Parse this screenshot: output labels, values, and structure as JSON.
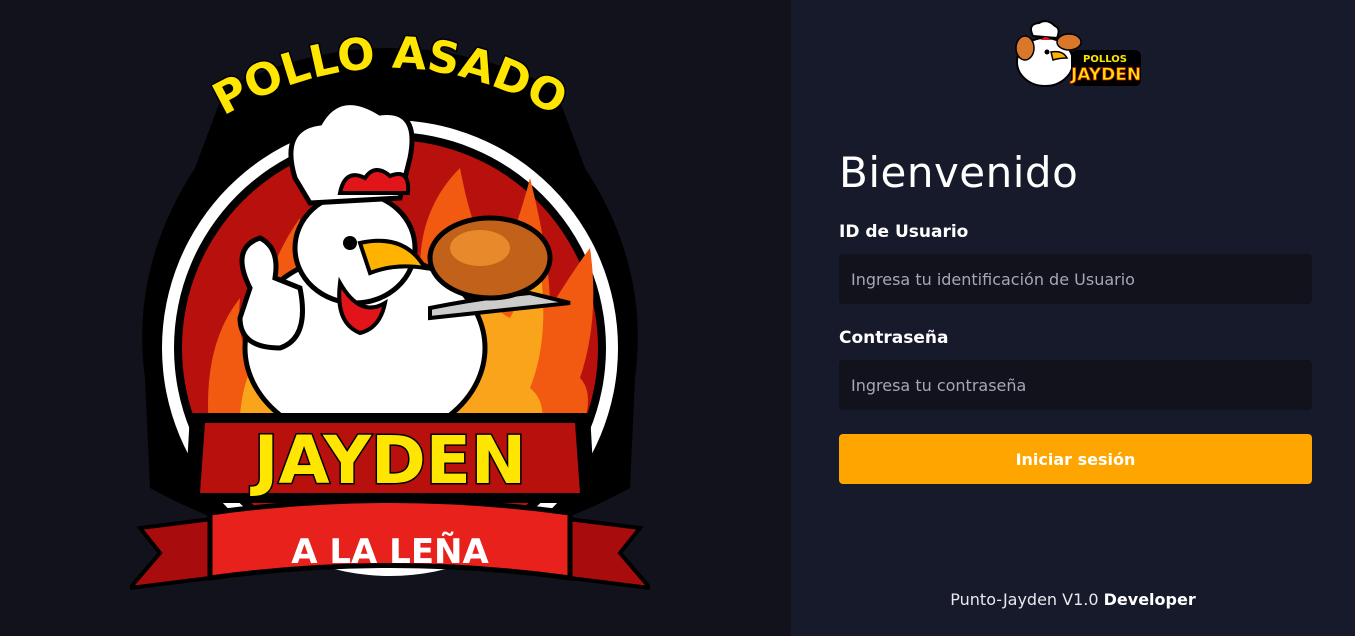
{
  "hero_logo": {
    "top_text": "POLLO ASADO",
    "brand": "JAYDEN",
    "ribbon": "A LA LEÑA",
    "icon": "chef-rooster-logo"
  },
  "brand_logo": {
    "line1": "POLLOS",
    "line2": "JAYDEN",
    "icon": "rooster-logo"
  },
  "login": {
    "title": "Bienvenido",
    "user_label": "ID de Usuario",
    "user_placeholder": "Ingresa tu identificación de Usuario",
    "user_value": "",
    "password_label": "Contraseña",
    "password_placeholder": "Ingresa tu contraseña",
    "password_value": "",
    "submit_label": "Iniciar sesión"
  },
  "footer": {
    "version": "Punto-Jayden V1.0",
    "credit": "Developer"
  },
  "colors": {
    "accent": "#ffa500",
    "panel_left": "#11121c",
    "panel_right": "#171a2b",
    "input_bg": "#11121c",
    "logo_yellow": "#ffe600",
    "logo_red": "#c0140f"
  }
}
